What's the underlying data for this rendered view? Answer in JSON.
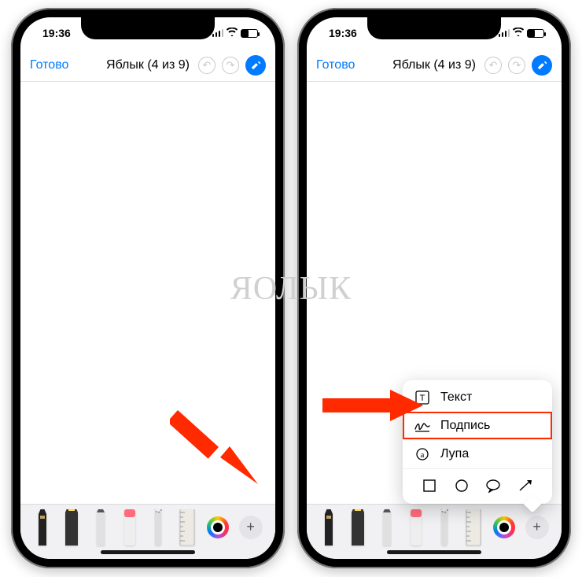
{
  "status": {
    "time": "19:36"
  },
  "nav": {
    "done": "Готово",
    "title": "Яблык (4 из 9)"
  },
  "watermark": "ЯОЛЫК",
  "icons": {
    "undo": "↶",
    "redo": "↷",
    "plus": "+"
  },
  "tools": {
    "names": [
      "pen-tool",
      "marker-tool",
      "pencil-tool",
      "eraser-tool",
      "lasso-tool",
      "ruler-tool"
    ]
  },
  "popover": {
    "text": "Текст",
    "signature": "Подпись",
    "magnifier": "Лупа"
  },
  "colors": {
    "accent": "#007aff",
    "arrow": "#ff2a00",
    "highlight": "#ff2a00"
  }
}
